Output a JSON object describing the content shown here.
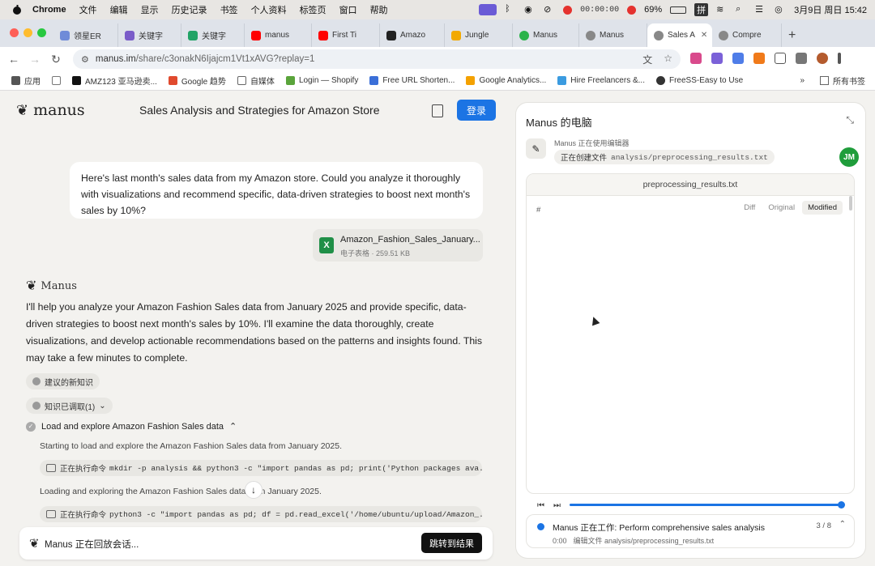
{
  "menubar": {
    "app": "Chrome",
    "items": [
      "文件",
      "编辑",
      "显示",
      "历史记录",
      "书签",
      "个人资料",
      "标签页",
      "窗口",
      "帮助"
    ],
    "recording_time": "00:00:00",
    "battery": "69%",
    "input_method": "拼",
    "datetime": "3月9日 周日 15:42"
  },
  "tabs": [
    {
      "label": "领星ER",
      "color": "#6f8bd8"
    },
    {
      "label": "关键字",
      "color": "#7a5cc9"
    },
    {
      "label": "关键字",
      "color": "#21a366"
    },
    {
      "label": "manus",
      "color": "#ff0000"
    },
    {
      "label": "First Ti",
      "color": "#ff0000"
    },
    {
      "label": "Amazo",
      "color": "#222222"
    },
    {
      "label": "Jungle",
      "color": "#f2a900"
    },
    {
      "label": "Manus",
      "color": "#2bb34a"
    },
    {
      "label": "Manus",
      "color": "#888888"
    },
    {
      "label": "Sales A",
      "color": "#888888"
    },
    {
      "label": "Compre",
      "color": "#888888"
    }
  ],
  "address": {
    "host": "manus.im",
    "path": "/share/c3onakN6Ijajcm1Vt1xAVG?replay=1"
  },
  "bookmarks": [
    {
      "label": "应用",
      "color": "#555555"
    },
    {
      "label": "",
      "color": "#777777"
    },
    {
      "label": "AMZ123 亚马逊卖...",
      "color": "#111111"
    },
    {
      "label": "Google 趋势",
      "color": "#e04a2e"
    },
    {
      "label": "自媒体",
      "color": "#666666"
    },
    {
      "label": "Login — Shopify",
      "color": "#5aa43b"
    },
    {
      "label": "Free URL Shorten...",
      "color": "#3b6fd8"
    },
    {
      "label": "Google Analytics...",
      "color": "#f4a100"
    },
    {
      "label": "Hire Freelancers &...",
      "color": "#3b9be0"
    },
    {
      "label": "FreeSS-Easy to Use",
      "color": "#333333"
    }
  ],
  "bookmarks_other": "所有书签",
  "header": {
    "brand": "manus",
    "title": "Sales Analysis and Strategies for Amazon Store",
    "login": "登录"
  },
  "user_message": "Here's last month's sales data from my Amazon store. Could you analyze it thoroughly with visualizations and recommend specific, data-driven strategies to boost next month's sales by 10%?",
  "attachment": {
    "name": "Amazon_Fashion_Sales_January...",
    "meta": "电子表格 · 259.51 KB",
    "icon_letter": "X"
  },
  "assistant": {
    "name": "Manus",
    "message": "I'll help you analyze your Amazon Fashion Sales data from January 2025 and provide specific, data-driven strategies to boost next month's sales by 10%. I'll examine the data thoroughly, create visualizations, and develop actionable recommendations based on the patterns and insights found. This may take a few minutes to complete.",
    "chip_suggest": "建议的新知识",
    "chip_knowledge": "知识已调取(1)",
    "step_title": "Load and explore Amazon Fashion Sales data",
    "line1": "Starting to load and explore the Amazon Fashion Sales data from January 2025.",
    "cmd1_label": "正在执行命令",
    "cmd1": "mkdir -p analysis && python3 -c \"import pandas as pd; print('Python packages ava...",
    "line2": "Loading and exploring the Amazon Fashion Sales data from January 2025.",
    "cmd2_label": "正在执行命令",
    "cmd2": "python3 -c \"import pandas as pd; df = pd.read_excel('/home/ubuntu/upload/Amazon_..."
  },
  "bottombar": {
    "status": "Manus 正在回放会话...",
    "jump": "跳转到结果"
  },
  "panel": {
    "title": "Manus 的电脑",
    "status_label": "Manus 正在使用编辑器",
    "status_action": "正在创建文件",
    "status_file": "analysis/preprocessing_results.txt",
    "avatar": "JM",
    "viewer_filename": "preprocessing_results.txt",
    "line_hash": "#",
    "modes": [
      "Diff",
      "Original",
      "Modified"
    ],
    "active_mode": "Modified",
    "progress": 1.0,
    "task_title": "Manus 正在工作: Perform comprehensive sales analysis",
    "task_time": "0:00",
    "task_sub": "编辑文件 analysis/preprocessing_results.txt",
    "task_count": "3 / 8"
  },
  "colors": {
    "accent": "#1b74e4",
    "excel": "#1f8f47",
    "avatar": "#1f9d3b"
  }
}
